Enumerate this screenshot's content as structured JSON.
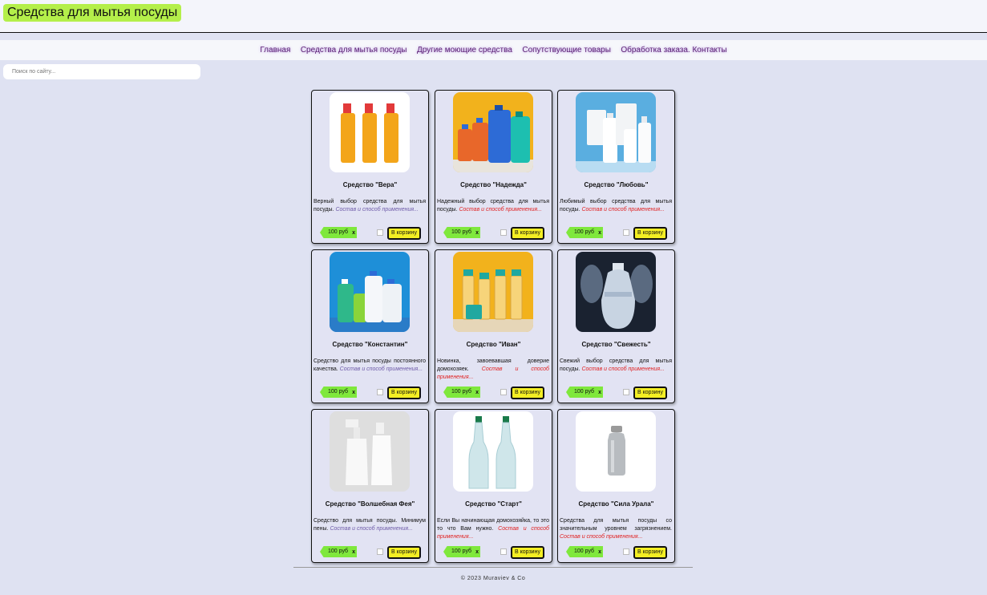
{
  "site": {
    "title": "Средства для мытья посуды"
  },
  "nav": {
    "items": [
      "Главная",
      "Средства для мытья посуды",
      "Другие моющие средства",
      "Сопутствующие товары",
      "Обработка заказа. Контакты"
    ]
  },
  "search": {
    "placeholder": "Поиск по сайту..."
  },
  "products": [
    {
      "title": "Средство \"Вера\"",
      "desc": "Верный выбор средства для мытья посуды.",
      "more": "Состав и способ применения...",
      "price": "100 руб",
      "remove": "x",
      "cart": "В корзину",
      "image": "orange-bottles"
    },
    {
      "title": "Средство \"Надежда\"",
      "desc": "Надежный выбор средства для мытья посуды.",
      "more": "Состав и способ применения...",
      "price": "100 руб",
      "remove": "x",
      "cart": "В корзину",
      "image": "color-jugs"
    },
    {
      "title": "Средство \"Любовь\"",
      "desc": "Любимый выбор средства для мытья посуды.",
      "more": "Состав и способ применения...",
      "price": "100 руб",
      "remove": "x",
      "cart": "В корзину",
      "image": "white-bottles"
    },
    {
      "title": "Средство \"Константин\"",
      "desc": "Средство для мытья посуды постоянного качества.",
      "more": "Состав и способ применения...",
      "price": "100 руб",
      "remove": "x",
      "cart": "В корзину",
      "image": "blue-jugs"
    },
    {
      "title": "Средство \"Иван\"",
      "desc": "Новинка, завоевавшая доверие домохозяек.",
      "more": "Состав и способ применения...",
      "price": "100 руб",
      "remove": "x",
      "cart": "В корзину",
      "image": "clear-bottles"
    },
    {
      "title": "Средство \"Свежесть\"",
      "desc": "Свежий выбор средства для мытья посуды.",
      "more": "Состав и способ применения...",
      "price": "100 руб",
      "remove": "x",
      "cart": "В корзину",
      "image": "water-bottles"
    },
    {
      "title": "Средство \"Волшебная Фея\"",
      "desc": "Средство для мытья посуды. Минимум пены.",
      "more": "Состав и способ применения...",
      "price": "100 руб",
      "remove": "x",
      "cart": "В корзину",
      "image": "spray-bottles"
    },
    {
      "title": "Средство \"Старт\"",
      "desc": "Если Вы начинающая домохозяйка, то это то что Вам нужно.",
      "more": "Состав и способ применения...",
      "price": "100 руб",
      "remove": "x",
      "cart": "В корзину",
      "image": "glass-bottles"
    },
    {
      "title": "Средство \"Сила Урала\"",
      "desc": "Средства для мытья посуды со значительным уровнем загрязнением.",
      "more": "Состав и способ применения...",
      "price": "100 руб",
      "remove": "x",
      "cart": "В корзину",
      "image": "steel-bottle"
    }
  ],
  "footer": {
    "text": "© 2023 Muraviev & Co"
  },
  "colors": {
    "accent": "#b4ef4a",
    "price_tag": "#7fe83c",
    "cart_button": "#f3ee23",
    "background": "#dfe2f2"
  }
}
